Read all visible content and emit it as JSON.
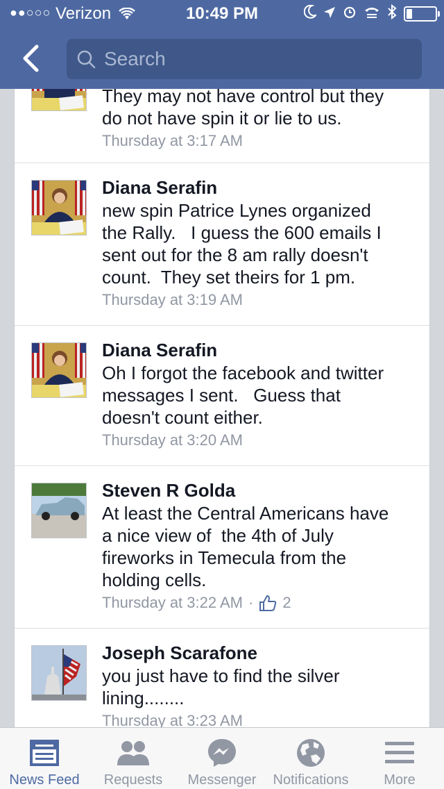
{
  "status_bar": {
    "carrier": "Verizon",
    "time": "10:49 PM",
    "signal_dots": "●●○○○"
  },
  "header": {
    "search_placeholder": "Search"
  },
  "comments": [
    {
      "author": "",
      "text": "They may not have control but they\ndo not have spin it or lie to us.",
      "time": "Thursday at 3:17 AM",
      "avatar": "diana-serafin-photo"
    },
    {
      "author": "Diana Serafin",
      "text": "new spin Patrice Lynes organized\nthe Rally.   I guess the 600 emails I\nsent out for the 8 am rally doesn't\ncount.  They set theirs for 1 pm.",
      "time": "Thursday at 3:19 AM",
      "avatar": "diana-serafin-photo"
    },
    {
      "author": "Diana Serafin",
      "text": "Oh I forgot the facebook and twitter\nmessages I sent.   Guess that\ndoesn't count either.",
      "time": "Thursday at 3:20 AM",
      "avatar": "diana-serafin-photo"
    },
    {
      "author": "Steven R Golda",
      "text": "At least the Central Americans have\na nice view of  the 4th of July\nfireworks in Temecula from the\nholding cells.",
      "time": "Thursday at 3:22 AM",
      "separator": "·",
      "likes": "2",
      "avatar": "car-photo"
    },
    {
      "author": "Joseph Scarafone",
      "text": "you just have to find the silver\nlining........",
      "time": "Thursday at 3:23 AM",
      "avatar": "capitol-flag-photo"
    }
  ],
  "tabbar": {
    "news_feed": "News Feed",
    "requests": "Requests",
    "messenger": "Messenger",
    "notifications": "Notifications",
    "more": "More"
  },
  "colors": {
    "brand_blue": "#4e69a2",
    "search_bg": "#3f5889",
    "meta_gray": "#9197a3"
  }
}
